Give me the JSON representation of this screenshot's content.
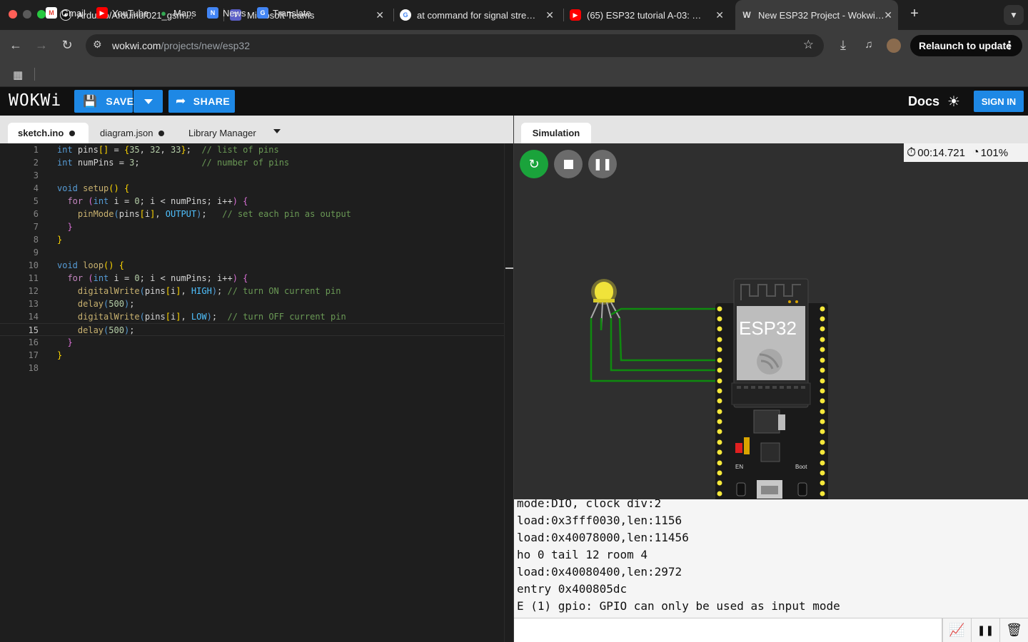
{
  "browser": {
    "tabs": [
      {
        "title": "Arduino/Arduino/021_gsm_m..."
      },
      {
        "title": "Microsoft Teams"
      },
      {
        "title": "at command for signal strengt..."
      },
      {
        "title": "(65) ESP32 tutorial A-03: The..."
      },
      {
        "title": "New ESP32 Project - Wokwi S..."
      }
    ],
    "url_host": "wokwi.com",
    "url_path": "/projects/new/esp32",
    "relaunch_label": "Relaunch to update",
    "bookmarks": [
      "Gmail",
      "YouTube",
      "Maps",
      "News",
      "Translate"
    ]
  },
  "wokwi": {
    "logo": "WOKWi",
    "save_label": "SAVE",
    "share_label": "SHARE",
    "docs_label": "Docs",
    "signin_label": "SIGN IN"
  },
  "editor": {
    "tabs": [
      "sketch.ino",
      "diagram.json",
      "Library Manager"
    ],
    "line_numbers": [
      "1",
      "2",
      "3",
      "4",
      "5",
      "6",
      "7",
      "8",
      "9",
      "10",
      "11",
      "12",
      "13",
      "14",
      "15",
      "16",
      "17",
      "18"
    ],
    "current_line": 15
  },
  "simulation": {
    "tab_label": "Simulation",
    "timer": "00:14.721",
    "speed": "101%",
    "chip_label": "ESP32",
    "en_label": "EN",
    "boot_label": "Boot"
  },
  "serial": {
    "lines": [
      "mode:DIO, clock div:2",
      "load:0x3fff0030,len:1156",
      "load:0x40078000,len:11456",
      "ho 0 tail 12 room 4",
      "load:0x40080400,len:2972",
      "entry 0x400805dc",
      "E (1) gpio: GPIO can only be used as input mode"
    ]
  },
  "colors": {
    "accent": "#1e88e5",
    "restart_green": "#1aa33b",
    "led_yellow": "#f5e83a",
    "wire_green": "#0f8a0f"
  }
}
